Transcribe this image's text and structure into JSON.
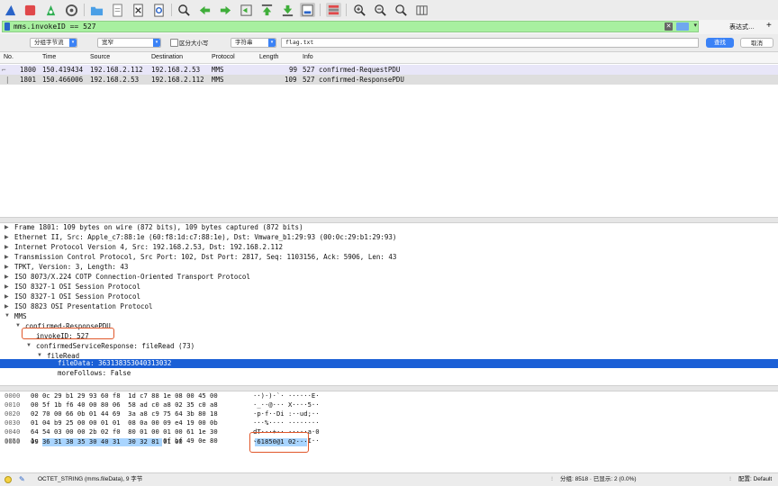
{
  "toolbar": {
    "icons": [
      "shark-fin-icon",
      "stop-icon",
      "restart-icon",
      "gear-icon",
      "open-folder-icon",
      "file-icon",
      "close-file-icon",
      "reload-icon",
      "search-icon",
      "back-arrow-icon",
      "forward-arrow-icon",
      "goto-packet-icon",
      "first-packet-icon",
      "last-packet-icon",
      "autoscroll-icon",
      "colorize-icon",
      "zoom-in-icon",
      "zoom-out-icon",
      "zoom-reset-icon",
      "resize-columns-icon"
    ]
  },
  "filter": {
    "value": "mms.invokeID == 527",
    "expression_label": "表达式…",
    "plus_label": "+"
  },
  "search": {
    "scope": "分组字节流",
    "width": "宽窄",
    "case_label": "区分大小写",
    "type": "字符串",
    "query": "flag.txt",
    "find_label": "查找",
    "cancel_label": "取消"
  },
  "packet_list": {
    "columns": [
      "No.",
      "Time",
      "Source",
      "Destination",
      "Protocol",
      "Length",
      "Info"
    ],
    "rows": [
      {
        "no": "1800",
        "time": "150.419434",
        "src": "192.168.2.112",
        "dst": "192.168.2.53",
        "proto": "MMS",
        "len": "99",
        "info": "527 confirmed-RequestPDU"
      },
      {
        "no": "1801",
        "time": "150.466006",
        "src": "192.168.2.53",
        "dst": "192.168.2.112",
        "proto": "MMS",
        "len": "109",
        "info": "527 confirmed-ResponsePDU"
      }
    ]
  },
  "details": [
    {
      "text": "Frame 1801: 109 bytes on wire (872 bits), 109 bytes captured (872 bits)",
      "arrow": "▶"
    },
    {
      "text": "Ethernet II, Src: Apple_c7:88:1e (60:f8:1d:c7:88:1e), Dst: Vmware_b1:29:93 (00:0c:29:b1:29:93)",
      "arrow": "▶"
    },
    {
      "text": "Internet Protocol Version 4, Src: 192.168.2.53, Dst: 192.168.2.112",
      "arrow": "▶"
    },
    {
      "text": "Transmission Control Protocol, Src Port: 102, Dst Port: 2817, Seq: 1103156, Ack: 5906, Len: 43",
      "arrow": "▶"
    },
    {
      "text": "TPKT, Version: 3, Length: 43",
      "arrow": "▶"
    },
    {
      "text": "ISO 8073/X.224 COTP Connection-Oriented Transport Protocol",
      "arrow": "▶"
    },
    {
      "text": "ISO 8327-1 OSI Session Protocol",
      "arrow": "▶"
    },
    {
      "text": "ISO 8327-1 OSI Session Protocol",
      "arrow": "▶"
    },
    {
      "text": "ISO 8823 OSI Presentation Protocol",
      "arrow": "▶"
    },
    {
      "text": "MMS",
      "arrow": "▼"
    },
    {
      "text": "confirmed-ResponsePDU",
      "arrow": "▼"
    },
    {
      "text": "invokeID: 527",
      "arrow": ""
    },
    {
      "text": "confirmedServiceResponse: fileRead (73)",
      "arrow": "▼"
    },
    {
      "text": "fileRead",
      "arrow": "▼"
    },
    {
      "text": "fileData: 363138353040313032",
      "arrow": ""
    },
    {
      "text": "moreFollows: False",
      "arrow": ""
    }
  ],
  "bytes": [
    {
      "off": "0000",
      "hex": "00 0c 29 b1 29 93 60 f8  1d c7 88 1e 08 00 45 00",
      "ascii": "··)·)·`· ······E·"
    },
    {
      "off": "0010",
      "hex": "00 5f 1b f6 40 00 80 06  58 ad c0 a8 02 35 c0 a8",
      "ascii": "·_··@··· X····5··"
    },
    {
      "off": "0020",
      "hex": "02 70 00 66 0b 01 44 69  3a a8 c9 75 64 3b 80 18",
      "ascii": "·p·f··Di :··ud;··"
    },
    {
      "off": "0030",
      "hex": "01 04 b9 25 00 00 01 01  08 0a 00 09 e4 19 00 0b",
      "ascii": "···%···· ········"
    },
    {
      "off": "0040",
      "hex": "64 54 03 00 00 2b 02 f0  80 01 00 01 00 61 1e 30",
      "ascii": "dT···+·· ·····a·0"
    },
    {
      "off": "0050",
      "hex": "1c 02 01 03 a0 17 a1 15  02 02 02 0f bf 49 0e 80",
      "ascii": "········ ·····I··"
    },
    {
      "off": "0060",
      "hex": "09 36 31 38 35 30 40 31  30 32 81 01 00",
      "ascii": "·61850@1 02···"
    }
  ],
  "status": {
    "field": "OCTET_STRING (mms.fileData), 9 字节",
    "packets": "分组: 8518 · 已显示: 2 (0.0%)",
    "profile": "配置: Default"
  },
  "colors": {
    "filter_ok": "#a8f0a0",
    "selection": "#1a5fd6",
    "highlight": "#e0572a",
    "hex_highlight": "#a9d5ff"
  }
}
